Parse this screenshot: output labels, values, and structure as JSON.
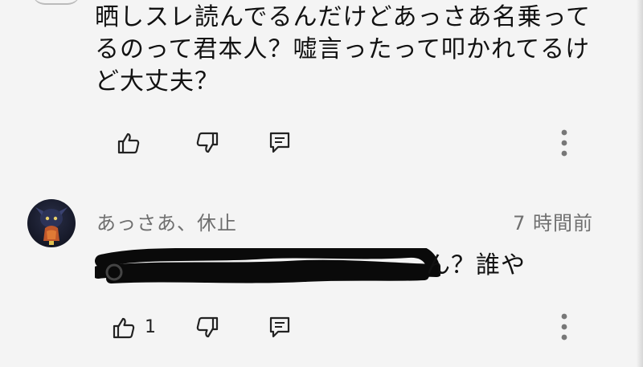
{
  "parent_comment": {
    "text": "晒しスレ読んでるんだけどあっさあ名乗ってるのって君本人？嘘言ったって叩かれてるけど大丈夫？"
  },
  "reply": {
    "author": "あっさあ、休止",
    "timestamp": "7 時間前",
    "text_visible": "ん？誰や",
    "like_count": "1"
  },
  "icons": {
    "like": "thumbs-up-icon",
    "dislike": "thumbs-down-icon",
    "reply": "reply-comment-icon",
    "more": "more-vert-icon"
  }
}
